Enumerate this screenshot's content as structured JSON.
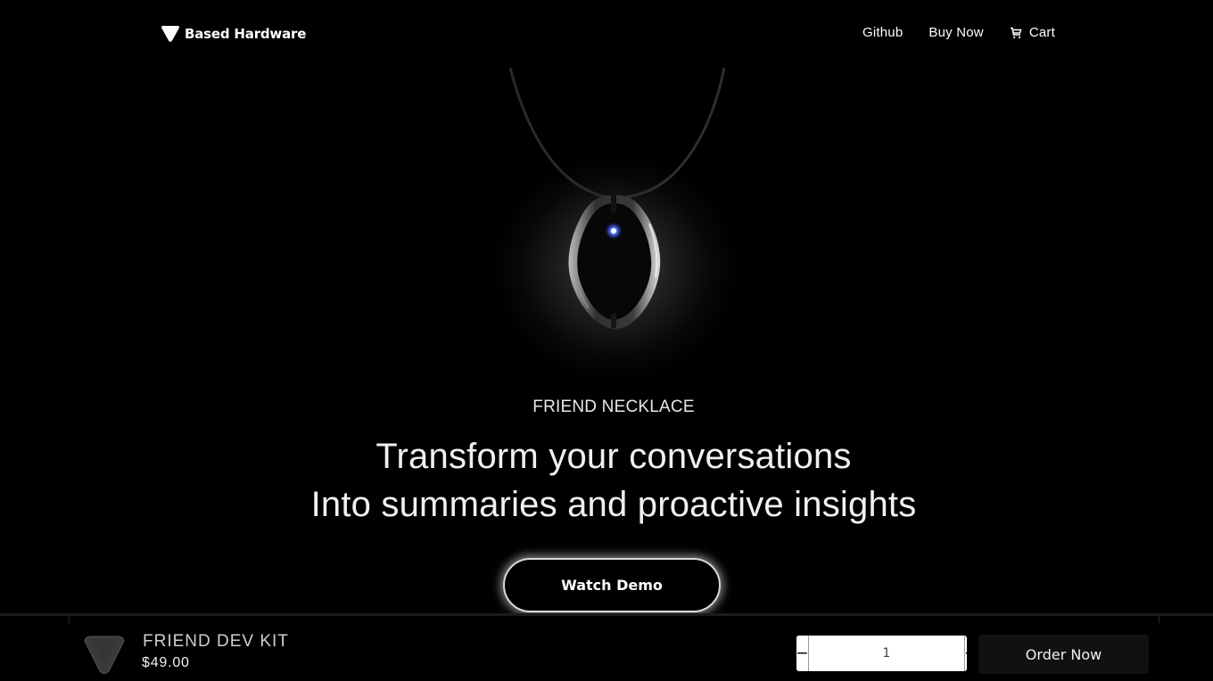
{
  "header": {
    "brand": "Based Hardware",
    "nav": [
      {
        "label": "Github"
      },
      {
        "label": "Buy Now"
      },
      {
        "label": "Cart",
        "icon": "cart-icon"
      }
    ]
  },
  "hero": {
    "image_alt": "Friend necklace pendant with blue LED",
    "eyebrow": "FRIEND NECKLACE",
    "headline_line1": "Transform your conversations",
    "headline_line2": "Into summaries and proactive insights",
    "cta_label": "Watch Demo"
  },
  "sticky_bar": {
    "product_name": "FRIEND DEV KIT",
    "price": "$49.00",
    "quantity": "1",
    "minus_label": "−",
    "plus_label": "+",
    "order_label": "Order Now"
  },
  "colors": {
    "background": "#000000",
    "text": "#ffffff",
    "led_blue": "#3a5cff",
    "order_button": "#111111"
  }
}
